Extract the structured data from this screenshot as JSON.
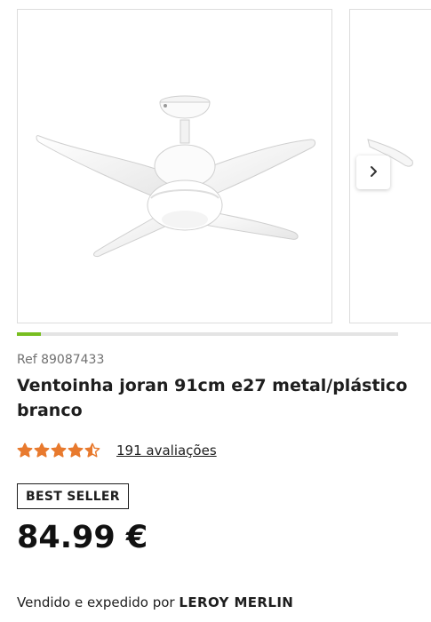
{
  "gallery": {
    "image_alt": "Ventoinha joran branca com 4 pás e luz",
    "next_icon": "chevron-right-icon",
    "progress": 0.064,
    "progress_color": "#78be20"
  },
  "product": {
    "ref": "Ref 89087433",
    "title": "Ventoinha joran 91cm e27 metal/plástico branco",
    "rating": 4.5,
    "reviews_label": "191 avaliações",
    "star_color": "#e87a2e",
    "badge": "BEST SELLER",
    "price": "84.99 €",
    "sold_by_prefix": "Vendido e expedido por",
    "seller": "LEROY MERLIN"
  }
}
